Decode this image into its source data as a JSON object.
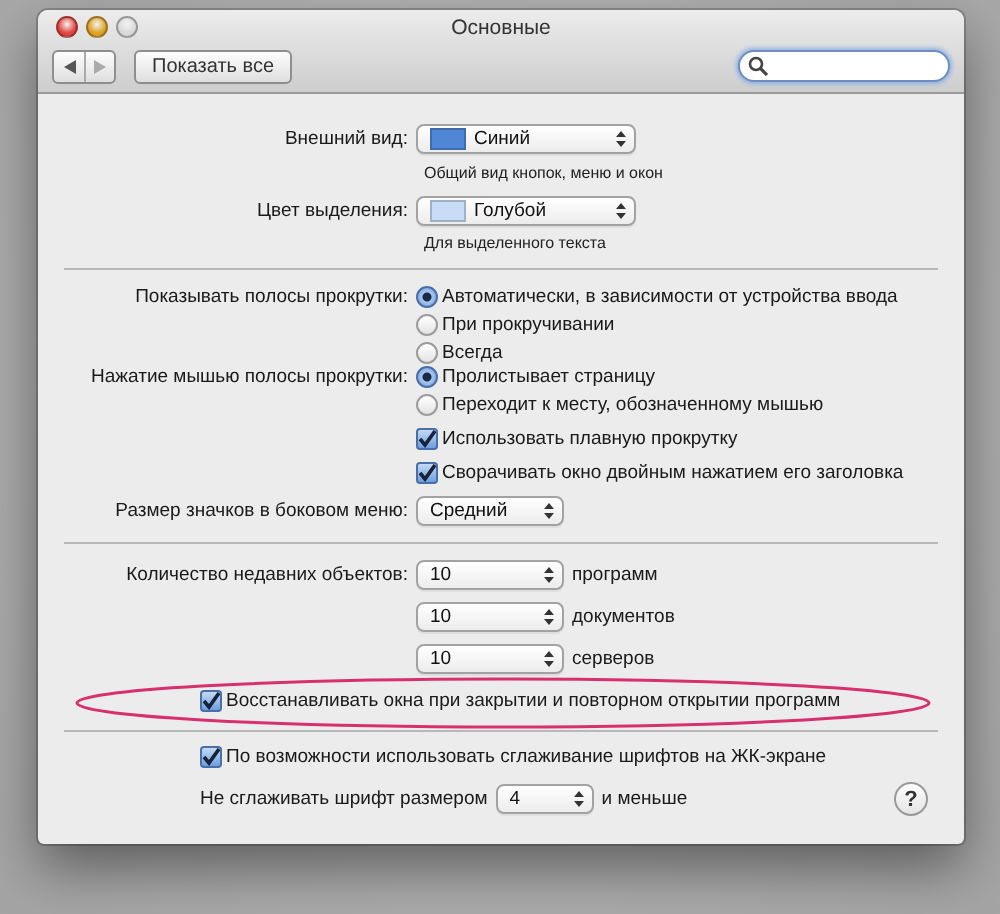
{
  "window": {
    "title": "Основные"
  },
  "toolbar": {
    "show_all": "Показать все"
  },
  "appearance": {
    "label": "Внешний вид:",
    "value": "Синий",
    "color": "#4f86d6",
    "hint": "Общий вид кнопок, меню и окон"
  },
  "highlight_color": {
    "label": "Цвет выделения:",
    "value": "Голубой",
    "color": "#c9dcf7",
    "hint": "Для выделенного текста"
  },
  "scroll_bars": {
    "label": "Показывать полосы прокрутки:",
    "options": [
      {
        "label": "Автоматически, в зависимости от устройства ввода",
        "selected": true
      },
      {
        "label": "При прокручивании",
        "selected": false
      },
      {
        "label": "Всегда",
        "selected": false
      }
    ]
  },
  "scroll_click": {
    "label": "Нажатие мышью полосы прокрутки:",
    "options": [
      {
        "label": "Пролистывает страницу",
        "selected": true
      },
      {
        "label": "Переходит к месту, обозначенному мышью",
        "selected": false
      }
    ]
  },
  "scroll_checks": [
    {
      "label": "Использовать плавную прокрутку",
      "checked": true
    },
    {
      "label": "Сворачивать окно двойным нажатием его заголовка",
      "checked": true
    }
  ],
  "sidebar_icon_size": {
    "label": "Размер значков в боковом меню:",
    "value": "Средний"
  },
  "recent_items": {
    "label": "Количество недавних объектов:",
    "rows": [
      {
        "value": "10",
        "unit": "программ"
      },
      {
        "value": "10",
        "unit": "документов"
      },
      {
        "value": "10",
        "unit": "серверов"
      }
    ]
  },
  "restore_windows": {
    "label": "Восстанавливать окна при закрытии и повторном открытии программ",
    "checked": true,
    "highlighted": true
  },
  "font_smoothing": {
    "label": "По возможности использовать сглаживание шрифтов на ЖК-экране",
    "checked": true
  },
  "min_font_size": {
    "label": "Не сглаживать шрифт размером",
    "value": "4",
    "suffix": "и меньше"
  },
  "help": {
    "label": "?"
  }
}
